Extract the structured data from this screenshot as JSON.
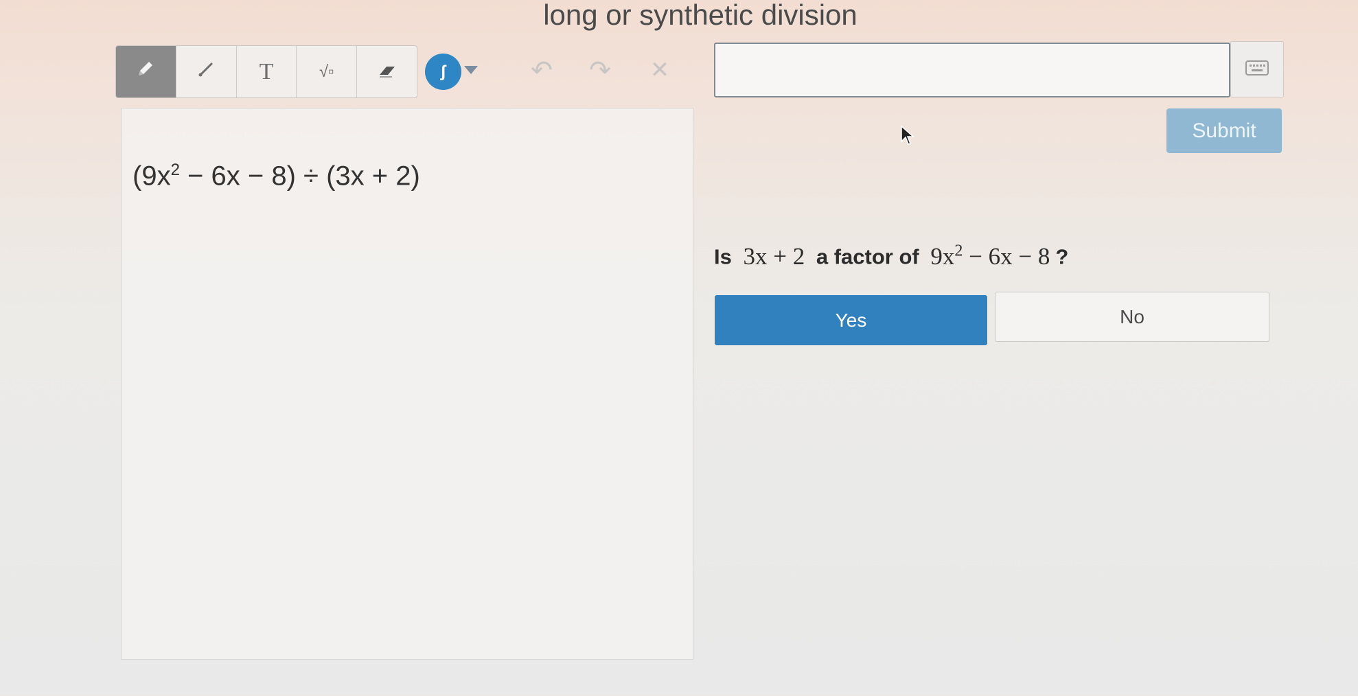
{
  "page": {
    "title": "long or synthetic division"
  },
  "toolbar": {
    "tools": [
      {
        "name": "pencil-icon",
        "glyph": "✎",
        "active": true
      },
      {
        "name": "line-icon",
        "glyph": "╱",
        "active": false
      },
      {
        "name": "text-icon",
        "glyph": "T",
        "active": false
      },
      {
        "name": "sqrt-icon",
        "glyph": "√▫",
        "active": false
      },
      {
        "name": "eraser-icon",
        "glyph": "⌫",
        "active": false
      }
    ],
    "color_picker_glyph": "ʃ",
    "color": "#2f86c4",
    "undo_glyph": "↶",
    "redo_glyph": "↷",
    "clear_glyph": "✕"
  },
  "answer": {
    "value": "",
    "placeholder": "",
    "keyboard_icon": "keyboard-icon",
    "submit_label": "Submit"
  },
  "problem": {
    "expression_base": "(9x",
    "expression_exp": "2",
    "expression_rest": " − 6x − 8) ÷ (3x + 2)"
  },
  "question": {
    "prefix": "Is",
    "divisor": "3x + 2",
    "middle": "a factor of",
    "poly_base": "9x",
    "poly_exp": "2",
    "poly_rest": " − 6x − 8",
    "suffix": "?"
  },
  "choices": {
    "yes_label": "Yes",
    "no_label": "No"
  },
  "colors": {
    "selected": "#3181bf",
    "submit_disabled": "#90b8d2"
  }
}
